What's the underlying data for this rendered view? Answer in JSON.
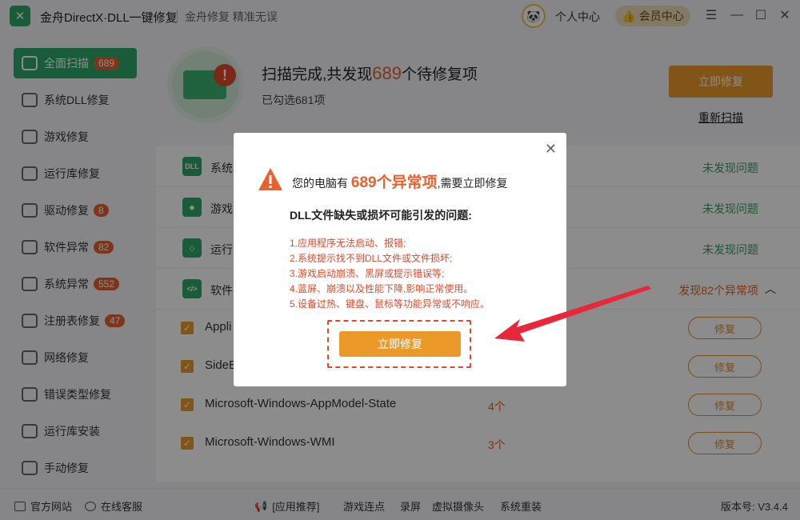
{
  "app": {
    "title": "金舟DirectX·DLL一键修复",
    "slogan": "金舟修复 精准无误",
    "user_center": "个人中心",
    "vip": "会员中心"
  },
  "sidebar": {
    "items": [
      {
        "label": "全面扫描",
        "badge": "689",
        "active": true
      },
      {
        "label": "系统DLL修复",
        "badge": ""
      },
      {
        "label": "游戏修复",
        "badge": ""
      },
      {
        "label": "运行库修复",
        "badge": ""
      },
      {
        "label": "驱动修复",
        "badge": "8"
      },
      {
        "label": "软件异常",
        "badge": "82"
      },
      {
        "label": "系统异常",
        "badge": "552"
      },
      {
        "label": "注册表修复",
        "badge": "47"
      },
      {
        "label": "网络修复",
        "badge": ""
      },
      {
        "label": "错误类型修复",
        "badge": ""
      },
      {
        "label": "运行库安装",
        "badge": ""
      },
      {
        "label": "手动修复",
        "badge": ""
      }
    ]
  },
  "scan": {
    "title_prefix": "扫描完成,共发现",
    "count": "689",
    "title_suffix": "个待修复项",
    "selected": "已勾选681项",
    "fix_now": "立即修复",
    "rescan": "重新扫描"
  },
  "categories": [
    {
      "icon": "DLL",
      "label": "系统",
      "status": "未发现问题"
    },
    {
      "icon": "",
      "label": "游戏",
      "status": "未发现问题"
    },
    {
      "icon": "",
      "label": "运行",
      "status": "未发现问题"
    },
    {
      "icon": "</>",
      "label": "软件",
      "status": "发现82个异常项"
    }
  ],
  "items": [
    {
      "name": "Appli",
      "count": "",
      "fix": "修复"
    },
    {
      "name": "SideB",
      "count": "",
      "fix": "修复"
    },
    {
      "name": "Microsoft-Windows-AppModel-State",
      "count": "4个",
      "fix": "修复"
    },
    {
      "name": "Microsoft-Windows-WMI",
      "count": "3个",
      "fix": "修复"
    }
  ],
  "footer": {
    "website": "官方网站",
    "service": "在线客服",
    "recommend": "[应用推荐]",
    "links": [
      "游戏连点",
      "录屏",
      "虚拟摄像头",
      "系统重装"
    ],
    "version": "版本号: V3.4.4"
  },
  "modal": {
    "head_prefix": "您的电脑有",
    "count": "689个异常项",
    "head_suffix": ",需要立即修复",
    "subtitle": "DLL文件缺失或损坏可能引发的问题:",
    "issues": [
      "1.应用程序无法启动、报错;",
      "2.系统提示找不到DLL文件或文件损坏;",
      "3.游戏启动崩溃、黑屏或提示错误等;",
      "4.蓝屏、崩溃以及性能下降,影响正常使用。",
      "5.设备过热、键盘、鼠标等功能异常或不响应。"
    ],
    "fix_button": "立即修复"
  },
  "colors": {
    "brand": "#2ea86a",
    "accent": "#eb9a2a",
    "alert": "#e04a2c"
  }
}
